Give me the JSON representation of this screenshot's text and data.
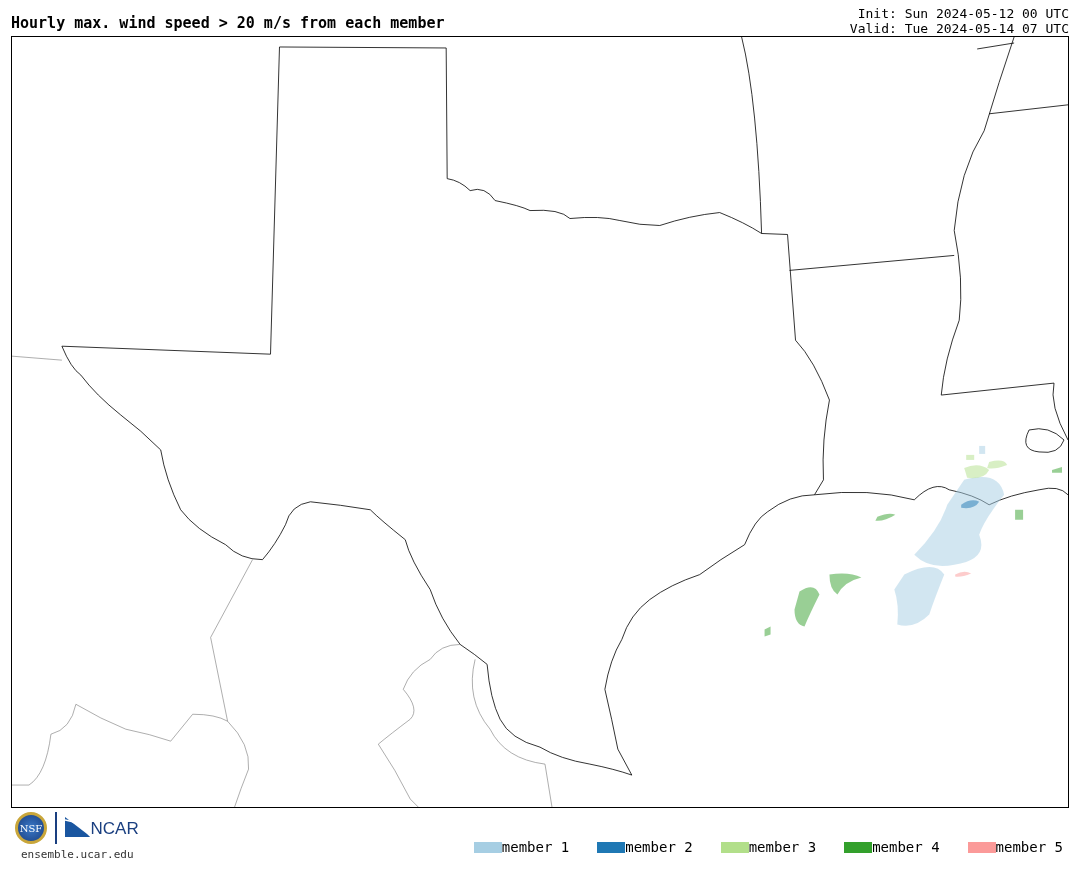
{
  "header": {
    "title": "Hourly max. wind speed > 20 m/s from each member",
    "init": "Init: Sun 2024-05-12 00 UTC",
    "valid": "Valid: Tue 2024-05-14 07 UTC"
  },
  "footer": {
    "nsf_logo": "NSF",
    "ncar_logo": "NCAR",
    "website": "ensemble.ucar.edu"
  },
  "legend": [
    {
      "label": "member 1",
      "color": "#a6cee3"
    },
    {
      "label": "member 2",
      "color": "#1f78b4"
    },
    {
      "label": "member 3",
      "color": "#b2df8a"
    },
    {
      "label": "member 4",
      "color": "#33a02c"
    },
    {
      "label": "member 5",
      "color": "#fb9a99"
    }
  ]
}
